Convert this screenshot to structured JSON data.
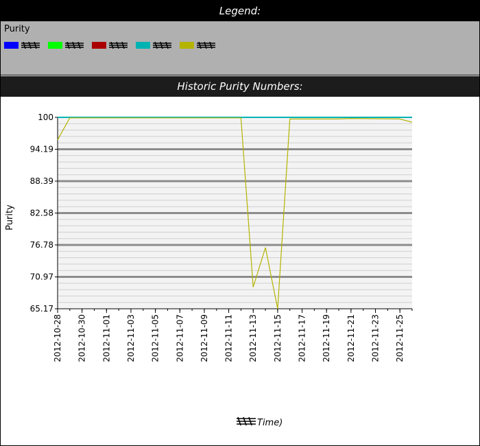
{
  "legend": {
    "header": "Legend:",
    "title": "Purity",
    "items": [
      {
        "color": "#0000ff"
      },
      {
        "color": "#00ff00"
      },
      {
        "color": "#aa0000"
      },
      {
        "color": "#00b3b3"
      },
      {
        "color": "#b3b300"
      }
    ]
  },
  "chart_header": "Historic Purity Numbers:",
  "chart_data": {
    "type": "line",
    "title": "Historic Purity Numbers:",
    "ylabel": "Purity",
    "xlabel": "Time)",
    "ylim": [
      65.17,
      100
    ],
    "yticks": [
      100,
      94.19,
      88.39,
      82.58,
      76.78,
      70.97,
      65.17
    ],
    "xlim": [
      "2012-10-28",
      "2012-11-26"
    ],
    "xticks": [
      "2012-10-28",
      "2012-10-30",
      "2012-11-01",
      "2012-11-03",
      "2012-11-05",
      "2012-11-07",
      "2012-11-09",
      "2012-11-11",
      "2012-11-13",
      "2012-11-15",
      "2012-11-17",
      "2012-11-19",
      "2012-11-21",
      "2012-11-23",
      "2012-11-25"
    ],
    "grid": true,
    "series": [
      {
        "color": "#00b3b3",
        "x": [
          "2012-10-28",
          "2012-11-26"
        ],
        "values": [
          100,
          100
        ]
      },
      {
        "color": "#b3b300",
        "x": [
          "2012-10-28",
          "2012-10-29",
          "2012-11-12",
          "2012-11-13",
          "2012-11-14",
          "2012-11-15",
          "2012-11-16",
          "2012-11-20",
          "2012-11-21",
          "2012-11-25",
          "2012-11-26"
        ],
        "values": [
          95.9,
          99.9,
          99.9,
          69.1,
          76.3,
          65.17,
          99.7,
          99.7,
          99.8,
          99.7,
          99.1
        ]
      }
    ]
  }
}
